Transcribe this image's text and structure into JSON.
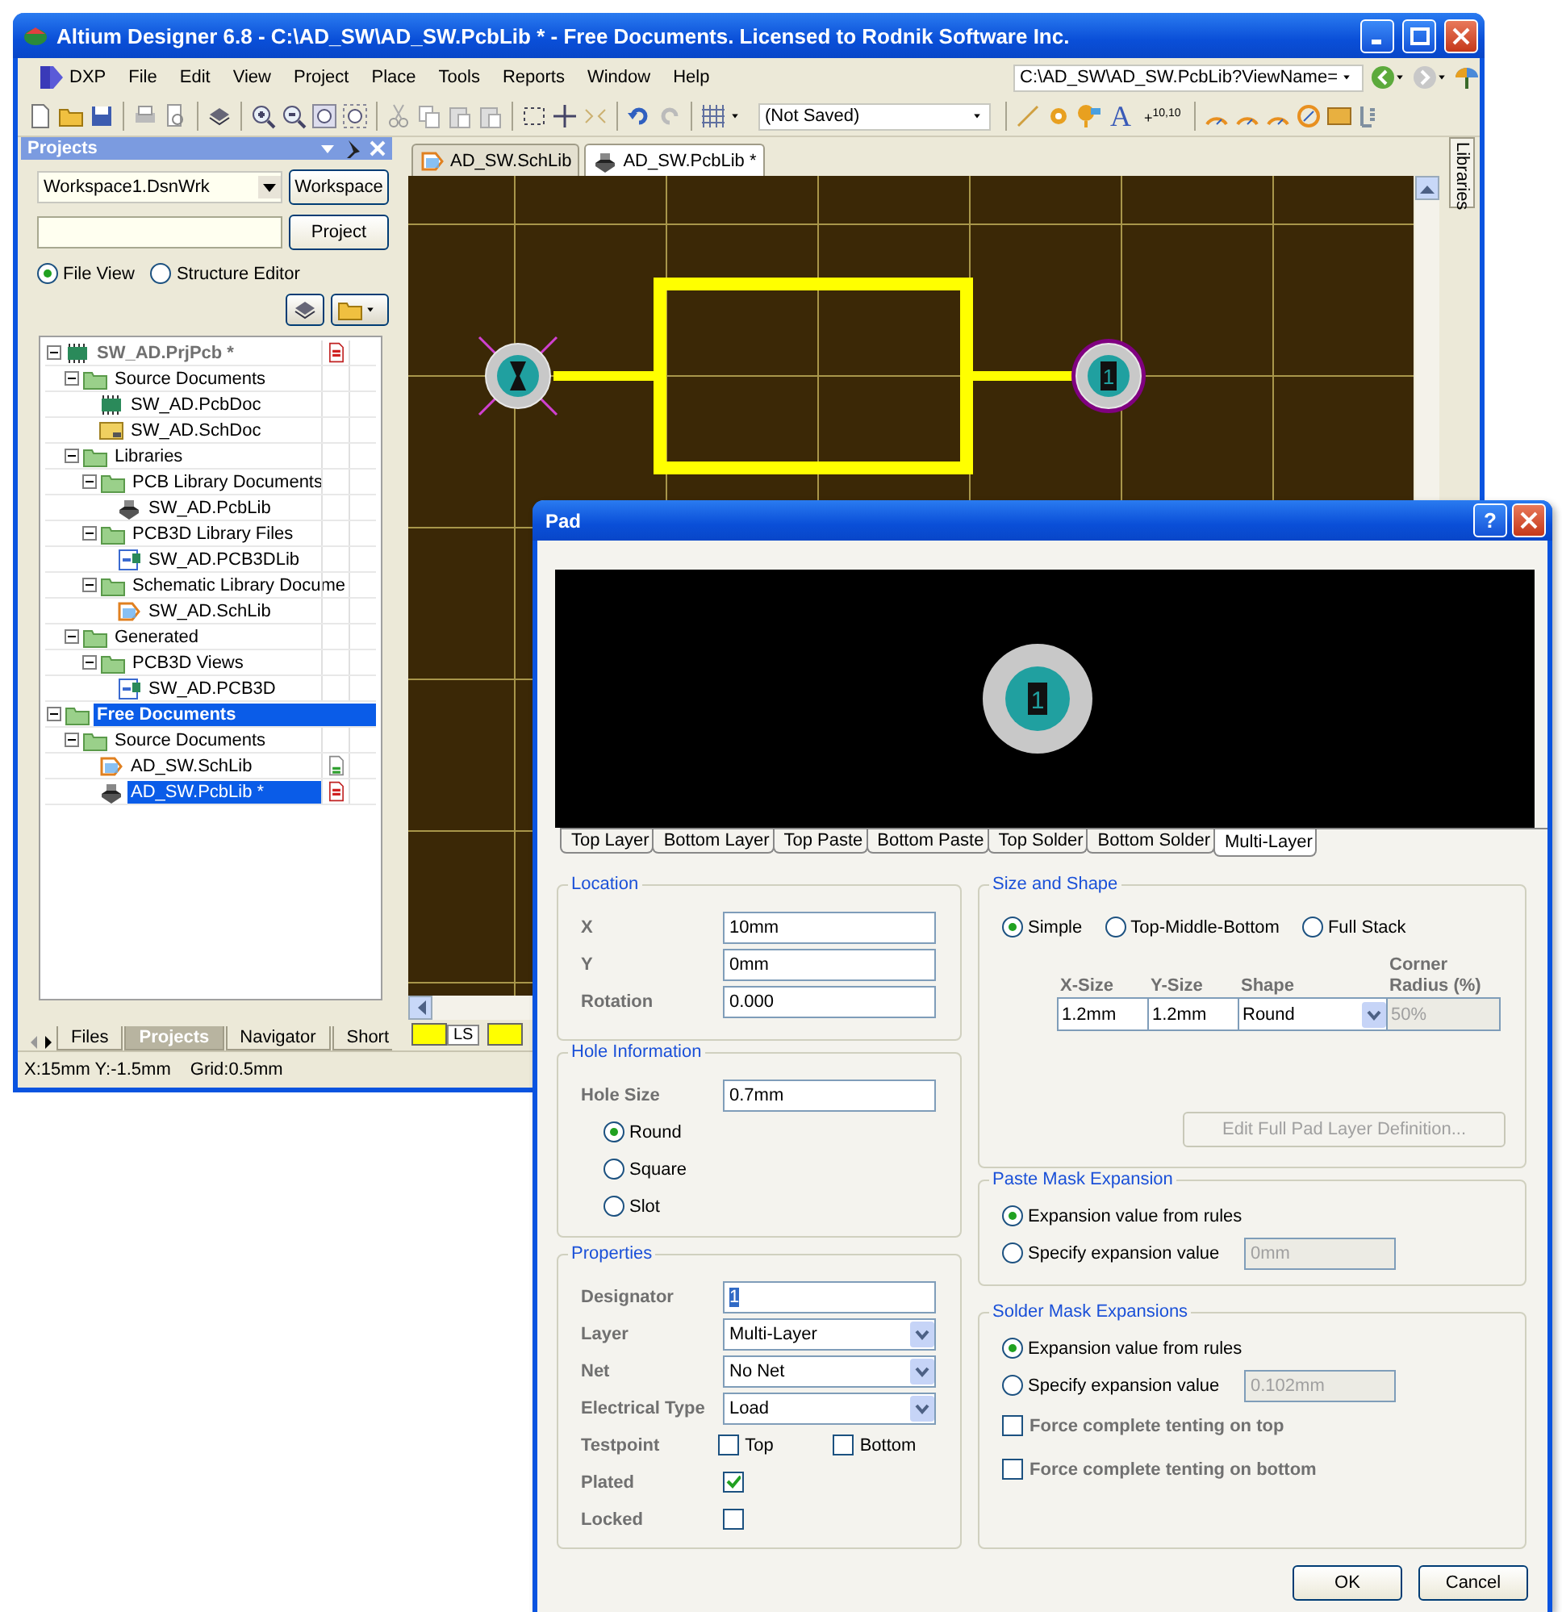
{
  "main_window": {
    "title": "Altium Designer 6.8 - C:\\AD_SW\\AD_SW.PcbLib * - Free Documents. Licensed to Rodnik Software Inc.",
    "menu": [
      "DXP",
      "File",
      "Edit",
      "View",
      "Project",
      "Place",
      "Tools",
      "Reports",
      "Window",
      "Help"
    ],
    "address": "C:\\AD_SW\\AD_SW.PcbLib?ViewName=",
    "view_combo": "(Not Saved)",
    "text_tool": "A",
    "coordinate_tool": "+$^{10,10}$",
    "projects_panel": {
      "title": "Projects",
      "workspace_combo": "Workspace1.DsnWrk",
      "buttons": [
        "Workspace",
        "Project"
      ],
      "view_options": [
        {
          "label": "File View",
          "selected": true
        },
        {
          "label": "Structure Editor",
          "selected": false
        }
      ],
      "tree": [
        {
          "label": "SW_AD.PrjPcb *",
          "kind": "project",
          "expanded": true,
          "selected": false,
          "saved": false,
          "children": [
            {
              "label": "Source Documents",
              "kind": "folder",
              "expanded": true,
              "selected": false,
              "children": [
                {
                  "label": "SW_AD.PcbDoc",
                  "kind": "pcbdoc",
                  "selected": false
                },
                {
                  "label": "SW_AD.SchDoc",
                  "kind": "schdoc",
                  "selected": false
                }
              ]
            },
            {
              "label": "Libraries",
              "kind": "folder",
              "expanded": true,
              "selected": false,
              "children": [
                {
                  "label": "PCB Library Documents",
                  "kind": "folder",
                  "expanded": true,
                  "selected": false,
                  "children": [
                    {
                      "label": "SW_AD.PcbLib",
                      "kind": "pcblib",
                      "selected": false
                    }
                  ]
                },
                {
                  "label": "PCB3D Library Files",
                  "kind": "folder",
                  "expanded": true,
                  "selected": false,
                  "children": [
                    {
                      "label": "SW_AD.PCB3DLib",
                      "kind": "pcb3dlib",
                      "selected": false
                    }
                  ]
                },
                {
                  "label": "Schematic Library Docume",
                  "kind": "folder",
                  "expanded": true,
                  "selected": false,
                  "children": [
                    {
                      "label": "SW_AD.SchLib",
                      "kind": "schlib",
                      "selected": false
                    }
                  ]
                }
              ]
            },
            {
              "label": "Generated",
              "kind": "folder",
              "expanded": true,
              "selected": false,
              "children": [
                {
                  "label": "PCB3D Views",
                  "kind": "folder",
                  "expanded": true,
                  "selected": false,
                  "children": [
                    {
                      "label": "SW_AD.PCB3D",
                      "kind": "pcb3dlib",
                      "selected": false
                    }
                  ]
                }
              ]
            }
          ]
        },
        {
          "label": "Free Documents",
          "kind": "group",
          "expanded": true,
          "selected": true,
          "children": [
            {
              "label": "Source Documents",
              "kind": "folder",
              "expanded": true,
              "selected": false,
              "children": [
                {
                  "label": "AD_SW.SchLib",
                  "kind": "schlib",
                  "selected": false,
                  "saved": true
                },
                {
                  "label": "AD_SW.PcbLib *",
                  "kind": "pcblib",
                  "selected": true,
                  "saved": false
                }
              ]
            }
          ]
        }
      ],
      "tabs": [
        {
          "label": "Files",
          "selected": false
        },
        {
          "label": "Projects",
          "selected": true
        },
        {
          "label": "Navigator",
          "selected": false
        },
        {
          "label": "Short",
          "selected": false
        }
      ]
    },
    "document_tabs": [
      {
        "label": "AD_SW.SchLib",
        "kind": "schlib",
        "selected": false
      },
      {
        "label": "AD_SW.PcbLib *",
        "kind": "pcblib",
        "selected": true
      }
    ],
    "side_tab": "Libraries",
    "canvas": {
      "pads": [
        {
          "selected": true
        },
        {
          "designator": "1",
          "selected": false
        }
      ]
    },
    "layer_tabs": [
      {
        "label": "LS",
        "color": "#ffff00"
      },
      {
        "color": "#ffff00"
      }
    ],
    "status_bar": [
      "X:15mm Y:-1.5mm",
      "Grid:0.5mm"
    ]
  },
  "pad_dialog": {
    "title": "Pad",
    "help_button": "?",
    "preview_designator": "1",
    "layer_tabs": [
      {
        "label": "Top Layer",
        "selected": false
      },
      {
        "label": "Bottom Layer",
        "selected": false
      },
      {
        "label": "Top Paste",
        "selected": false
      },
      {
        "label": "Bottom Paste",
        "selected": false
      },
      {
        "label": "Top Solder",
        "selected": false
      },
      {
        "label": "Bottom Solder",
        "selected": false
      },
      {
        "label": "Multi-Layer",
        "selected": true
      }
    ],
    "location": {
      "title": "Location",
      "fields": [
        {
          "label": "X",
          "value": "10mm"
        },
        {
          "label": "Y",
          "value": "0mm"
        },
        {
          "label": "Rotation",
          "value": "0.000"
        }
      ]
    },
    "hole": {
      "title": "Hole Information",
      "label": "Hole Size",
      "value": "0.7mm",
      "shapes": [
        {
          "label": "Round",
          "selected": true
        },
        {
          "label": "Square",
          "selected": false
        },
        {
          "label": "Slot",
          "selected": false
        }
      ]
    },
    "properties": {
      "title": "Properties",
      "rows": [
        {
          "kind": "text",
          "label": "Designator",
          "value": "1",
          "text_selected": true
        },
        {
          "kind": "combo",
          "label": "Layer",
          "value": "Multi-Layer"
        },
        {
          "kind": "combo",
          "label": "Net",
          "value": "No Net"
        },
        {
          "kind": "combo",
          "label": "Electrical Type",
          "value": "Load"
        },
        {
          "kind": "checks",
          "label": "Testpoint",
          "options": [
            {
              "label": "Top",
              "checked": false
            },
            {
              "label": "Bottom",
              "checked": false
            }
          ]
        },
        {
          "kind": "check",
          "label": "Plated",
          "checked": true
        },
        {
          "kind": "check",
          "label": "Locked",
          "checked": false
        }
      ]
    },
    "size_shape": {
      "title": "Size and Shape",
      "modes": [
        {
          "label": "Simple",
          "selected": true
        },
        {
          "label": "Top-Middle-Bottom",
          "selected": false
        },
        {
          "label": "Full Stack",
          "selected": false
        }
      ],
      "columns": [
        "X-Size",
        "Y-Size",
        "Shape",
        "Corner Radius (%)"
      ],
      "row": [
        {
          "kind": "text",
          "value": "1.2mm"
        },
        {
          "kind": "text",
          "value": "1.2mm"
        },
        {
          "kind": "combo",
          "value": "Round"
        },
        {
          "kind": "text",
          "value": "50%",
          "disabled": true
        }
      ],
      "button": {
        "label": "Edit Full Pad Layer Definition...",
        "disabled": true
      }
    },
    "paste_mask": {
      "title": "Paste Mask Expansion",
      "options": [
        {
          "label": "Expansion value from rules",
          "selected": true
        },
        {
          "label": "Specify expansion value",
          "selected": false,
          "value": "0mm",
          "disabled": true
        }
      ]
    },
    "solder_mask": {
      "title": "Solder Mask Expansions",
      "options": [
        {
          "label": "Expansion value from rules",
          "selected": true
        },
        {
          "label": "Specify expansion value",
          "selected": false,
          "value": "0.102mm",
          "disabled": true
        }
      ],
      "checks": [
        {
          "label": "Force complete tenting on top",
          "checked": false
        },
        {
          "label": "Force complete tenting on bottom",
          "checked": false
        }
      ]
    },
    "buttons": [
      "OK",
      "Cancel"
    ]
  }
}
